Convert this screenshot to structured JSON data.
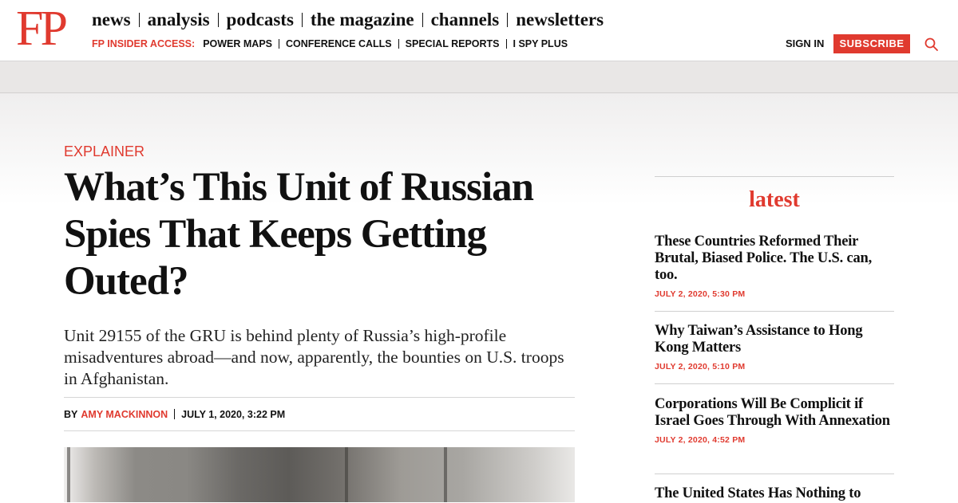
{
  "header": {
    "logo": "FP",
    "primary_nav": [
      "news",
      "analysis",
      "podcasts",
      "the magazine",
      "channels",
      "newsletters"
    ],
    "insider_label": "FP INSIDER ACCESS:",
    "insider_links": [
      "POWER MAPS",
      "CONFERENCE CALLS",
      "SPECIAL REPORTS",
      "I SPY PLUS"
    ],
    "signin": "SIGN IN",
    "subscribe": "SUBSCRIBE",
    "search_icon": "search-icon",
    "accent_color": "#e03a2f"
  },
  "article": {
    "kicker": "EXPLAINER",
    "headline": "What’s This Unit of Russian Spies That Keeps Getting Outed?",
    "dek": "Unit 29155 of the GRU is behind plenty of Russia’s high-profile misadventures abroad—and now, apparently, the bounties on U.S. troops in Afghanistan.",
    "byline_prefix": "BY",
    "author": "AMY MACKINNON",
    "date": "JULY 1, 2020, 3:22 PM"
  },
  "sidebar": {
    "title": "latest",
    "stories": [
      {
        "title": "These Countries Reformed Their Brutal, Biased Police. The U.S. can, too.",
        "date": "JULY 2, 2020, 5:30 PM"
      },
      {
        "title": "Why Taiwan’s Assistance to Hong Kong Matters",
        "date": "JULY 2, 2020, 5:10 PM"
      },
      {
        "title": "Corporations Will Be Complicit if Israel Goes Through With Annexation",
        "date": "JULY 2, 2020, 4:52 PM"
      },
      {
        "title": "The United States Has Nothing to",
        "date": ""
      }
    ]
  }
}
